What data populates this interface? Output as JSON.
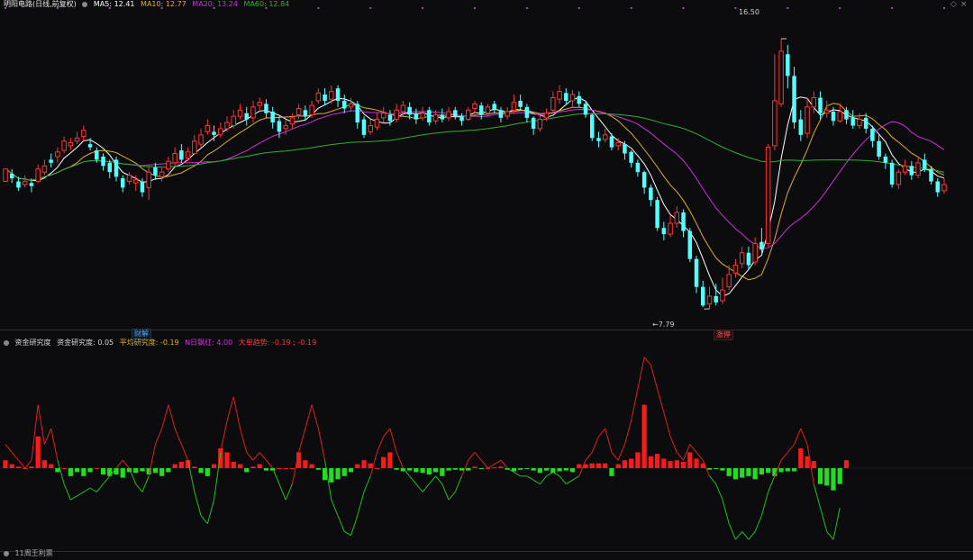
{
  "main_header": {
    "title": "明阳电路(日线,前复权)",
    "ma5_label": "MA5: 12.41",
    "ma10_label": "MA10: 12.77",
    "ma20_label": "MA20: 13.24",
    "ma60_label": "MA60: 12.84"
  },
  "sub_header": {
    "name": "资金研究度",
    "value_label": "资金研究度: 0.05",
    "avg_label": "平均研究度: -0.19",
    "n_label": "N日飘红: 4.00",
    "big_label": "大单趋势: -0.19 ; -0.19"
  },
  "annotations": {
    "high_label": "16.50",
    "low_label": "←7.79",
    "event_caijie": "财解",
    "event_zhangting": "涨停"
  },
  "bottom_tab": "11周王利票",
  "colors": {
    "up": "#ff3333",
    "down": "#54ffff",
    "ma5": "#ffffff",
    "ma10": "#e0b020",
    "ma20": "#d030e0",
    "ma60": "#30b030",
    "bar_pos": "#ff1a1a",
    "bar_neg": "#22dd22",
    "line_red": "#e02020",
    "line_green": "#20c020",
    "background": "#0c0c0e"
  },
  "chart_data": [
    {
      "type": "candlestick",
      "series_names": [
        "MA5",
        "MA10",
        "MA20",
        "MA60"
      ],
      "ylim": [
        7.3,
        17.4
      ],
      "candles": [
        [
          11.9,
          12.3,
          12.1,
          11.95
        ],
        [
          12.15,
          12.0,
          12.3,
          11.85
        ],
        [
          11.9,
          11.7,
          12.05,
          11.6
        ],
        [
          11.8,
          11.9,
          12.1,
          11.7
        ],
        [
          11.85,
          11.75,
          12.0,
          11.55
        ],
        [
          11.9,
          12.3,
          12.45,
          11.85
        ],
        [
          12.2,
          12.4,
          12.6,
          12.1
        ],
        [
          12.6,
          12.5,
          12.8,
          12.35
        ],
        [
          12.7,
          12.85,
          13.0,
          12.5
        ],
        [
          12.9,
          13.2,
          13.35,
          12.8
        ],
        [
          13.05,
          13.15,
          13.3,
          12.9
        ],
        [
          13.2,
          13.3,
          13.5,
          13.1
        ],
        [
          13.35,
          13.55,
          13.7,
          13.2
        ],
        [
          13.1,
          13.0,
          13.3,
          12.9
        ],
        [
          12.9,
          12.6,
          13.0,
          12.5
        ],
        [
          12.7,
          12.4,
          12.8,
          12.25
        ],
        [
          12.5,
          12.2,
          12.6,
          12.0
        ],
        [
          12.6,
          12.05,
          12.7,
          11.9
        ],
        [
          12.0,
          11.7,
          12.1,
          11.55
        ],
        [
          11.9,
          12.1,
          12.2,
          11.8
        ],
        [
          11.85,
          11.95,
          12.1,
          11.6
        ],
        [
          11.9,
          11.55,
          12.0,
          11.4
        ],
        [
          11.7,
          12.2,
          12.4,
          11.3
        ],
        [
          12.35,
          12.1,
          12.5,
          11.95
        ],
        [
          12.05,
          12.2,
          12.35,
          11.9
        ],
        [
          12.3,
          12.55,
          12.7,
          12.2
        ],
        [
          12.5,
          12.8,
          13.0,
          12.4
        ],
        [
          12.9,
          12.6,
          13.1,
          12.5
        ],
        [
          12.65,
          12.85,
          13.0,
          12.55
        ],
        [
          12.8,
          13.2,
          13.4,
          12.75
        ],
        [
          13.1,
          13.4,
          13.6,
          13.0
        ],
        [
          13.5,
          13.7,
          13.9,
          13.4
        ],
        [
          13.5,
          13.4,
          13.7,
          13.2
        ],
        [
          13.4,
          13.6,
          13.8,
          13.3
        ],
        [
          13.6,
          13.8,
          14.0,
          13.5
        ],
        [
          13.7,
          14.0,
          14.2,
          13.6
        ],
        [
          14.0,
          14.2,
          14.4,
          13.9
        ],
        [
          14.1,
          13.9,
          14.3,
          13.7
        ],
        [
          13.95,
          14.3,
          14.5,
          13.8
        ],
        [
          14.35,
          14.45,
          14.6,
          14.2
        ],
        [
          14.4,
          14.1,
          14.55,
          13.95
        ],
        [
          14.15,
          13.8,
          14.3,
          13.6
        ],
        [
          13.85,
          13.5,
          14.0,
          13.3
        ],
        [
          13.6,
          13.7,
          13.9,
          13.4
        ],
        [
          13.75,
          13.95,
          14.1,
          13.6
        ],
        [
          14.05,
          14.25,
          14.4,
          13.9
        ],
        [
          14.2,
          14.0,
          14.35,
          13.85
        ],
        [
          14.05,
          14.35,
          14.5,
          13.95
        ],
        [
          14.5,
          14.75,
          14.9,
          14.4
        ],
        [
          14.7,
          14.5,
          14.9,
          14.35
        ],
        [
          14.55,
          14.8,
          15.0,
          14.4
        ],
        [
          14.9,
          14.5,
          15.0,
          14.3
        ],
        [
          14.5,
          14.25,
          14.7,
          14.1
        ],
        [
          14.3,
          14.4,
          14.6,
          14.15
        ],
        [
          14.4,
          13.8,
          14.5,
          13.6
        ],
        [
          13.9,
          13.4,
          14.0,
          13.3
        ],
        [
          13.5,
          13.7,
          13.9,
          13.4
        ],
        [
          13.65,
          13.9,
          14.1,
          13.55
        ],
        [
          13.95,
          14.1,
          14.3,
          13.8
        ],
        [
          14.05,
          13.85,
          14.2,
          13.7
        ],
        [
          13.9,
          14.2,
          14.4,
          13.8
        ],
        [
          14.15,
          14.35,
          14.5,
          14.0
        ],
        [
          14.3,
          14.05,
          14.45,
          13.9
        ],
        [
          14.1,
          13.9,
          14.25,
          13.75
        ],
        [
          13.95,
          14.1,
          14.3,
          13.85
        ],
        [
          14.2,
          13.8,
          14.3,
          13.7
        ],
        [
          13.85,
          14.05,
          14.2,
          13.75
        ],
        [
          14.05,
          13.9,
          14.25,
          13.8
        ],
        [
          13.95,
          14.15,
          14.3,
          13.85
        ],
        [
          14.2,
          14.0,
          14.3,
          13.9
        ],
        [
          14.0,
          13.85,
          14.1,
          13.7
        ],
        [
          13.9,
          14.2,
          14.3,
          13.85
        ],
        [
          14.25,
          14.4,
          14.5,
          14.1
        ],
        [
          14.35,
          14.05,
          14.45,
          13.9
        ],
        [
          14.1,
          14.3,
          14.4,
          14.0
        ],
        [
          14.4,
          14.2,
          14.5,
          14.1
        ],
        [
          14.2,
          13.95,
          14.3,
          13.8
        ],
        [
          14.0,
          14.15,
          14.3,
          13.9
        ],
        [
          14.2,
          14.45,
          14.7,
          14.1
        ],
        [
          14.5,
          14.3,
          14.7,
          14.2
        ],
        [
          14.3,
          13.95,
          14.4,
          13.8
        ],
        [
          13.95,
          13.6,
          14.0,
          13.4
        ],
        [
          13.6,
          13.9,
          14.1,
          13.5
        ],
        [
          13.95,
          14.1,
          14.25,
          13.85
        ],
        [
          14.2,
          14.6,
          14.8,
          14.1
        ],
        [
          14.55,
          14.8,
          15.0,
          14.4
        ],
        [
          14.75,
          14.5,
          14.9,
          14.4
        ],
        [
          14.5,
          14.7,
          14.85,
          14.3
        ],
        [
          14.65,
          14.4,
          14.8,
          14.3
        ],
        [
          14.4,
          14.05,
          14.5,
          13.95
        ],
        [
          14.05,
          13.3,
          14.1,
          13.2
        ],
        [
          13.3,
          13.2,
          13.5,
          13.0
        ],
        [
          13.25,
          13.4,
          13.6,
          13.15
        ],
        [
          13.35,
          13.0,
          13.45,
          12.9
        ],
        [
          13.05,
          13.15,
          13.3,
          12.9
        ],
        [
          13.1,
          12.8,
          13.2,
          12.6
        ],
        [
          12.85,
          12.5,
          12.9,
          12.35
        ],
        [
          12.5,
          12.2,
          12.6,
          12.05
        ],
        [
          12.2,
          11.7,
          12.25,
          11.5
        ],
        [
          11.7,
          11.3,
          11.8,
          11.1
        ],
        [
          11.3,
          10.4,
          11.4,
          10.3
        ],
        [
          10.4,
          10.2,
          10.6,
          10.0
        ],
        [
          10.2,
          10.55,
          10.8,
          10.1
        ],
        [
          10.55,
          10.9,
          11.1,
          10.4
        ],
        [
          10.9,
          10.3,
          11.0,
          10.1
        ],
        [
          10.3,
          9.4,
          10.4,
          9.3
        ],
        [
          9.4,
          8.5,
          9.5,
          8.3
        ],
        [
          8.5,
          7.9,
          8.7,
          7.85
        ],
        [
          7.95,
          8.2,
          8.5,
          7.79
        ],
        [
          8.2,
          8.0,
          8.6,
          7.9
        ],
        [
          8.05,
          8.4,
          8.8,
          7.95
        ],
        [
          8.5,
          8.9,
          9.2,
          8.4
        ],
        [
          8.95,
          9.2,
          9.4,
          8.8
        ],
        [
          9.25,
          9.6,
          9.8,
          9.1
        ],
        [
          9.6,
          9.2,
          9.8,
          9.05
        ],
        [
          9.3,
          9.9,
          10.1,
          9.2
        ],
        [
          9.95,
          9.7,
          10.4,
          9.6
        ],
        [
          9.9,
          13.0,
          13.1,
          9.8
        ],
        [
          13.05,
          14.5,
          16.0,
          12.9
        ],
        [
          14.4,
          16.1,
          16.5,
          14.3
        ],
        [
          16.0,
          15.3,
          16.3,
          14.9
        ],
        [
          15.3,
          13.8,
          15.6,
          13.6
        ],
        [
          13.9,
          13.4,
          14.2,
          13.2
        ],
        [
          13.45,
          14.3,
          14.6,
          13.3
        ],
        [
          14.3,
          14.6,
          14.8,
          14.1
        ],
        [
          14.6,
          14.1,
          14.8,
          13.9
        ],
        [
          14.1,
          14.2,
          14.5,
          13.95
        ],
        [
          14.15,
          13.85,
          14.3,
          13.7
        ],
        [
          13.85,
          14.15,
          14.4,
          13.8
        ],
        [
          14.2,
          13.9,
          14.3,
          13.75
        ],
        [
          13.95,
          13.7,
          14.2,
          13.6
        ],
        [
          13.7,
          13.9,
          14.1,
          13.6
        ],
        [
          13.95,
          13.6,
          14.1,
          13.45
        ],
        [
          13.6,
          13.2,
          13.7,
          13.0
        ],
        [
          13.2,
          12.7,
          13.4,
          12.6
        ],
        [
          12.7,
          12.5,
          12.8,
          12.3
        ],
        [
          12.5,
          11.8,
          12.6,
          11.7
        ],
        [
          11.8,
          12.2,
          12.3,
          11.65
        ],
        [
          12.2,
          12.4,
          12.6,
          12.1
        ],
        [
          12.4,
          12.1,
          12.55,
          11.95
        ],
        [
          12.1,
          12.5,
          12.7,
          12.0
        ],
        [
          12.6,
          12.3,
          12.8,
          12.2
        ],
        [
          12.3,
          11.9,
          12.4,
          11.8
        ],
        [
          11.9,
          11.55,
          12.0,
          11.4
        ],
        [
          11.6,
          11.8,
          12.0,
          11.5
        ]
      ],
      "high": 16.5,
      "low": 7.79
    },
    {
      "type": "bar",
      "name": "资金研究度",
      "ylim": [
        -1.0,
        1.5
      ],
      "values": [
        0.1,
        0.05,
        0.02,
        0.0,
        0.02,
        0.4,
        0.1,
        0.05,
        -0.05,
        0.0,
        -0.1,
        -0.05,
        -0.1,
        -0.05,
        0.0,
        -0.08,
        -0.1,
        -0.08,
        -0.12,
        -0.05,
        -0.06,
        -0.04,
        -0.08,
        -0.06,
        -0.1,
        -0.05,
        0.05,
        0.08,
        0.1,
        0.02,
        -0.06,
        -0.1,
        0.05,
        0.25,
        0.2,
        0.08,
        0.05,
        -0.05,
        0.02,
        0.05,
        -0.03,
        -0.03,
        0.0,
        0.0,
        0.0,
        0.2,
        0.1,
        0.05,
        -0.02,
        -0.15,
        -0.18,
        -0.14,
        -0.1,
        -0.05,
        0.05,
        0.1,
        0.06,
        0.0,
        0.14,
        0.2,
        -0.02,
        -0.04,
        -0.03,
        -0.05,
        -0.06,
        -0.08,
        -0.05,
        -0.1,
        -0.03,
        -0.02,
        -0.03,
        -0.03,
        0.02,
        -0.01,
        0.0,
        0.01,
        0.02,
        -0.02,
        -0.04,
        -0.02,
        -0.01,
        -0.03,
        -0.06,
        -0.03,
        -0.06,
        -0.04,
        -0.03,
        -0.05,
        0.05,
        0.05,
        0.06,
        0.06,
        0.06,
        -0.1,
        0.05,
        0.1,
        0.12,
        0.2,
        0.8,
        0.15,
        0.18,
        0.12,
        0.09,
        0.1,
        0.08,
        0.2,
        0.12,
        0.06,
        -0.02,
        -0.01,
        -0.03,
        -0.1,
        -0.14,
        -0.12,
        -0.1,
        -0.14,
        -0.08,
        -0.06,
        -0.1,
        -0.05,
        -0.04,
        -0.04,
        0.25,
        0.15,
        0.09,
        -0.2,
        -0.22,
        -0.28,
        -0.2,
        0.1
      ],
      "line_values": [
        0.3,
        0.2,
        0.1,
        0.0,
        0.1,
        0.8,
        0.3,
        0.5,
        0.1,
        -0.2,
        -0.4,
        -0.35,
        -0.3,
        -0.25,
        -0.3,
        -0.2,
        -0.1,
        0.0,
        0.1,
        0.0,
        -0.2,
        -0.3,
        -0.1,
        0.3,
        0.5,
        0.8,
        0.5,
        0.3,
        0.1,
        -0.3,
        -0.6,
        -0.7,
        -0.4,
        0.2,
        0.6,
        0.9,
        0.5,
        0.2,
        0.1,
        0.2,
        0.1,
        0.0,
        -0.2,
        -0.4,
        -0.2,
        0.2,
        0.5,
        0.8,
        0.5,
        0.1,
        -0.4,
        -0.6,
        -0.8,
        -0.85,
        -0.6,
        -0.3,
        -0.1,
        0.2,
        0.4,
        0.5,
        0.2,
        0.0,
        -0.1,
        -0.2,
        -0.3,
        -0.2,
        -0.1,
        -0.2,
        -0.4,
        -0.3,
        -0.1,
        0.1,
        0.2,
        0.1,
        0.0,
        0.05,
        0.1,
        0.0,
        -0.05,
        -0.1,
        -0.1,
        -0.15,
        -0.2,
        -0.1,
        -0.05,
        -0.1,
        -0.2,
        -0.15,
        -0.1,
        0.1,
        0.2,
        0.4,
        0.5,
        0.2,
        0.1,
        0.3,
        0.6,
        1.0,
        1.4,
        1.3,
        1.0,
        0.7,
        0.4,
        0.2,
        0.1,
        0.3,
        0.2,
        0.1,
        -0.1,
        -0.2,
        -0.4,
        -0.7,
        -0.9,
        -0.8,
        -0.9,
        -0.8,
        -0.6,
        -0.3,
        -0.1,
        0.1,
        0.2,
        0.3,
        0.5,
        0.3,
        -0.2,
        -0.5,
        -0.8,
        -0.9,
        -0.5
      ]
    }
  ]
}
